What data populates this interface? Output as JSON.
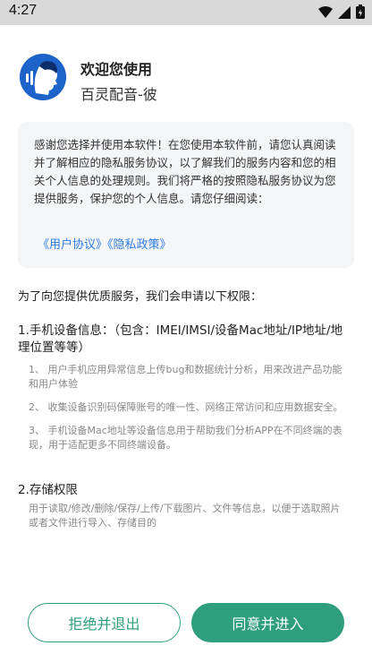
{
  "status_bar": {
    "time": "4:27"
  },
  "header": {
    "welcome": "欢迎您使用",
    "app_name": "百灵配音-彼"
  },
  "notice": {
    "text": "感谢您选择并使用本软件！在您使用本软件前，请您认真阅读并了解相应的隐私服务协议，以了解我们的服务内容和您的相关个人信息的处理规则。我们将严格的按照隐私服务协议为您提供服务，保护您的个人信息。请您仔细阅读：",
    "user_agreement": "《用户协议》",
    "privacy_policy": "《隐私政策》"
  },
  "permissions": {
    "intro": "为了向您提供优质服务，我们会申请以下权限：",
    "device": {
      "title": "1.手机设备信息：（包含：IMEI/IMSI/设备Mac地址/IP地址/地理位置等等）",
      "items": [
        "1、 用户手机应用异常信息上传bug和数据统计分析，用来改进产品功能和用户体验",
        "2、 收集设备识别码保障账号的唯一性、网络正常访问和应用数据安全。",
        "3、 手机设备Mac地址等设备信息用于帮助我们分析APP在不同终端的表现，用于适配更多不同终端设备。"
      ]
    },
    "storage": {
      "title": "2.存储权限",
      "desc": "用于读取/修改/删除/保存/上传/下载图片、文件等信息，以便于选取照片或者文件进行导入、存储目的"
    }
  },
  "buttons": {
    "reject": "拒绝并退出",
    "accept": "同意并进入"
  },
  "colors": {
    "accent": "#2e9e7c",
    "link": "#2d7be0",
    "card_bg": "#f4f5f7"
  }
}
